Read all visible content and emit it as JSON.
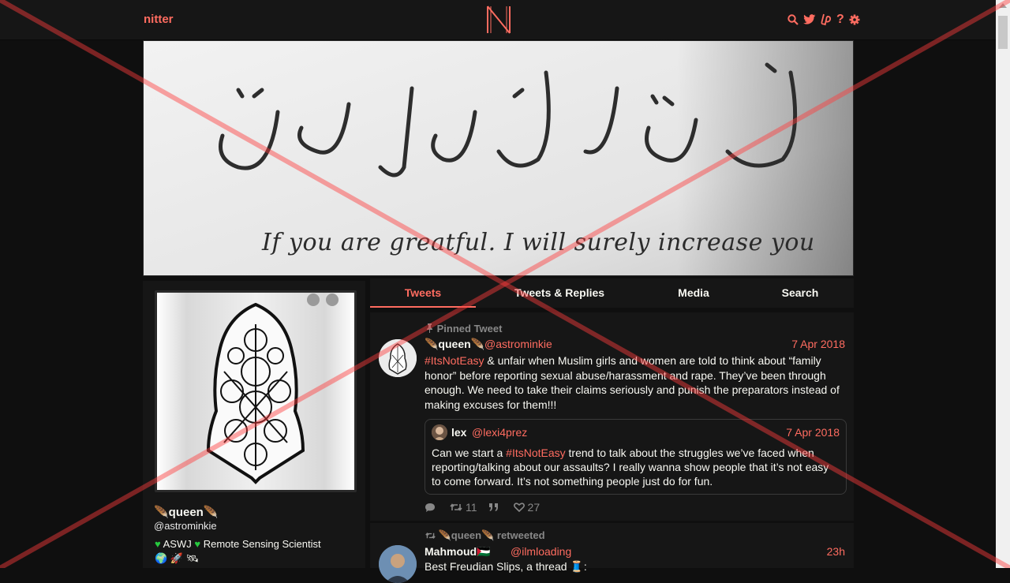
{
  "nav": {
    "brand": "nitter",
    "help_glyph": "?",
    "icons": [
      "search-icon",
      "twitter-icon",
      "liberapay-icon",
      "help-icon",
      "gear-icon"
    ]
  },
  "banner": {
    "caption": "If you are greatful. I will surely increase you"
  },
  "profile": {
    "fullname": "🪶queen🪶",
    "username": "@astrominkie",
    "bio_line1": "ASWJ",
    "bio_line1b": "Remote Sensing Scientist",
    "bio_line2": "🌍 🚀 🛰"
  },
  "tabs": [
    {
      "label": "Tweets",
      "active": true
    },
    {
      "label": "Tweets & Replies",
      "active": false
    },
    {
      "label": "Media",
      "active": false
    },
    {
      "label": "Search",
      "active": false
    }
  ],
  "tweet1": {
    "pinned_label": "Pinned Tweet",
    "fullname": "🪶queen🪶",
    "username": "@astrominkie",
    "date": "7 Apr 2018",
    "hashtag": "#ItsNotEasy",
    "text": " & unfair when Muslim girls and women are told to think about “family honor” before reporting sexual abuse/harassment and rape. They’ve been through enough. We need to take their claims seriously and punish the preparators instead of making excuses for them!!!",
    "quote": {
      "fullname": "lex",
      "username": "@lexi4prez",
      "date": "7 Apr 2018",
      "text_before": "Can we start a ",
      "hashtag": "#ItsNotEasy",
      "text_after": " trend to talk about the struggles we’ve faced when reporting/talking about our assaults? I really wanna show people that it’s not easy to come forward. It’s not something people just do for fun."
    },
    "stats": {
      "replies": "",
      "retweets": "11",
      "quotes": "",
      "likes": "27"
    }
  },
  "tweet2": {
    "retweet_label": "🪶queen🪶 retweeted",
    "fullname": "Mahmoud🇵🇸",
    "username": "@ilmloading",
    "date": "23h",
    "text": "Best Freudian Slips, a thread 🧵:"
  },
  "colors": {
    "accent": "#ff6c60",
    "background": "#0f0f0f",
    "panel": "#161616",
    "muted": "#888888",
    "bio_heart": "#27c93f"
  }
}
